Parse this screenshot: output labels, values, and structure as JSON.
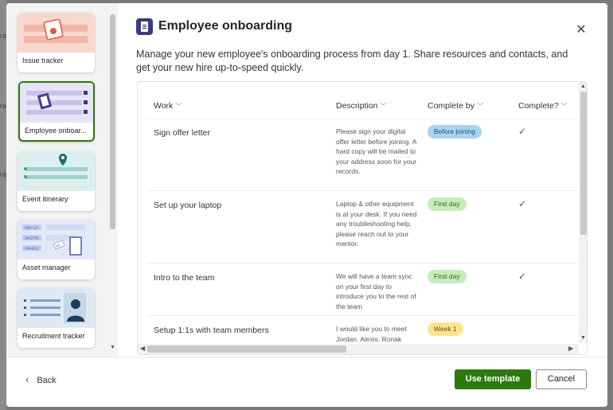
{
  "background_list": {
    "partial_labels": [
      "ra",
      "ra",
      "ra"
    ]
  },
  "templates": [
    {
      "label": "Issue tracker",
      "accent": "#f8d7cf"
    },
    {
      "label": "Employee onboar...",
      "accent": "#e6e4f5",
      "selected": true
    },
    {
      "label": "Event itinerary",
      "accent": "#dcefee"
    },
    {
      "label": "Asset manager",
      "accent": "#e3e8f7",
      "tags": [
        "5987114",
        "1643756",
        "7094612",
        "Id4"
      ]
    },
    {
      "label": "Recruitment tracker",
      "accent": "#dfe9f3"
    }
  ],
  "header": {
    "title": "Employee onboarding",
    "description": "Manage your new employee's onboarding process from day 1. Share resources and contacts, and get your new hire up-to-speed quickly."
  },
  "table": {
    "columns": [
      "Work",
      "Description",
      "Complete by",
      "Complete?"
    ],
    "rows": [
      {
        "work": "Sign offer letter",
        "description": "Please sign your digital offer letter before joining. A hard copy will be mailed to your address soon for your records.",
        "complete_by": "Before joining",
        "pill_color": "#a9d3f0",
        "complete": "✓"
      },
      {
        "work": "Set up your laptop",
        "description": "Laptop & other equipment is at your desk. If you need any troubleshooting help, please reach out to your mentor.",
        "complete_by": "First day",
        "pill_color": "#c5ecb9",
        "complete": "✓"
      },
      {
        "work": "Intro to the team",
        "description": "We will have a team sync on your first day to introduce you to the rest of the team",
        "complete_by": "First day",
        "pill_color": "#c5ecb9",
        "complete": "✓"
      },
      {
        "work": "Setup 1:1s with team members",
        "description": "I would like you to meet Jordan, Alexis, Ronak",
        "complete_by": "Week 1",
        "pill_color": "#fbe48f",
        "complete": ""
      }
    ]
  },
  "footer": {
    "back_label": "Back",
    "use_template_label": "Use template",
    "cancel_label": "Cancel"
  },
  "colors": {
    "primary": "#2b7a0b",
    "title_icon": "#3b3a7a"
  }
}
